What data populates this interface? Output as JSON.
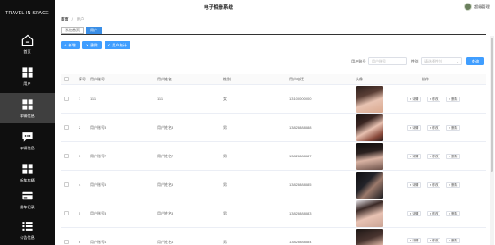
{
  "app": {
    "title": "电子相册系统",
    "brand": "TRAVEL IN SPACE",
    "user": "超级管理"
  },
  "sidebar": {
    "items": [
      {
        "label": "首页",
        "icon": "home-icon"
      },
      {
        "label": "用户",
        "icon": "user-grid-icon"
      },
      {
        "label": "车辆信息",
        "icon": "grid-icon"
      },
      {
        "label": "车辆信息",
        "icon": "chat-icon"
      },
      {
        "label": "新车车辆",
        "icon": "grid-icon"
      },
      {
        "label": "用车记录",
        "icon": "card-icon"
      },
      {
        "label": "公告信息",
        "icon": "list-icon"
      }
    ]
  },
  "breadcrumb": {
    "home": "首页",
    "current": "用户"
  },
  "tabs": [
    {
      "label": "系统首页"
    },
    {
      "label": "用户"
    }
  ],
  "toolbar": {
    "add": "新增",
    "delete": "删除",
    "report": "用户统计"
  },
  "filters": {
    "account_label": "用户账号",
    "account_placeholder": "用户账号",
    "gender_label": "性别",
    "gender_placeholder": "请选择性别",
    "search": "查询"
  },
  "table": {
    "columns": [
      "序号",
      "用户账号",
      "用户姓名",
      "性别",
      "用户电话",
      "头像",
      "操作"
    ],
    "ops": {
      "detail": "详情",
      "edit": "修改",
      "delete": "删除"
    },
    "rows": [
      {
        "index": "1",
        "account": "111",
        "name": "111",
        "gender": "女",
        "phone": "13100000000"
      },
      {
        "index": "2",
        "account": "用户账号8",
        "name": "用户姓名8",
        "gender": "男",
        "phone": "13823888888"
      },
      {
        "index": "3",
        "account": "用户账号7",
        "name": "用户姓名7",
        "gender": "男",
        "phone": "13823888887"
      },
      {
        "index": "4",
        "account": "用户账号5",
        "name": "用户姓名5",
        "gender": "男",
        "phone": "13823888885"
      },
      {
        "index": "5",
        "account": "用户账号3",
        "name": "用户姓名3",
        "gender": "男",
        "phone": "13823888883"
      },
      {
        "index": "6",
        "account": "用户账号4",
        "name": "用户姓名4",
        "gender": "男",
        "phone": "13823888884"
      }
    ]
  }
}
